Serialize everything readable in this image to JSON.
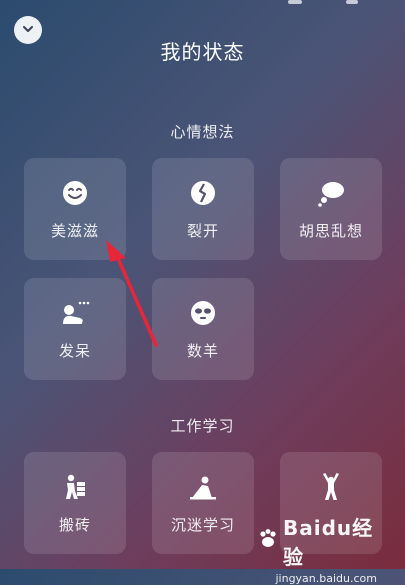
{
  "header": {
    "title": "我的状态",
    "back_icon": "chevron-down-icon"
  },
  "sections": [
    {
      "title": "心情想法",
      "items": [
        {
          "label": "美滋滋",
          "icon": "smile-icon"
        },
        {
          "label": "裂开",
          "icon": "cracked-heart-icon"
        },
        {
          "label": "胡思乱想",
          "icon": "thought-bubble-icon"
        },
        {
          "label": "发呆",
          "icon": "daze-icon"
        },
        {
          "label": "数羊",
          "icon": "sleep-mask-icon"
        }
      ]
    },
    {
      "title": "工作学习",
      "items": [
        {
          "label": "搬砖",
          "icon": "brick-carrier-icon"
        },
        {
          "label": "沉迷学习",
          "icon": "studying-icon"
        },
        {
          "label": "",
          "icon": "stretch-person-icon"
        }
      ]
    }
  ],
  "watermark": {
    "brand": "Baidu经验",
    "url": "jingyan.baidu.com"
  },
  "colors": {
    "annotation_arrow": "#e8263a",
    "tile_bg": "rgba(255,255,255,0.12)"
  }
}
